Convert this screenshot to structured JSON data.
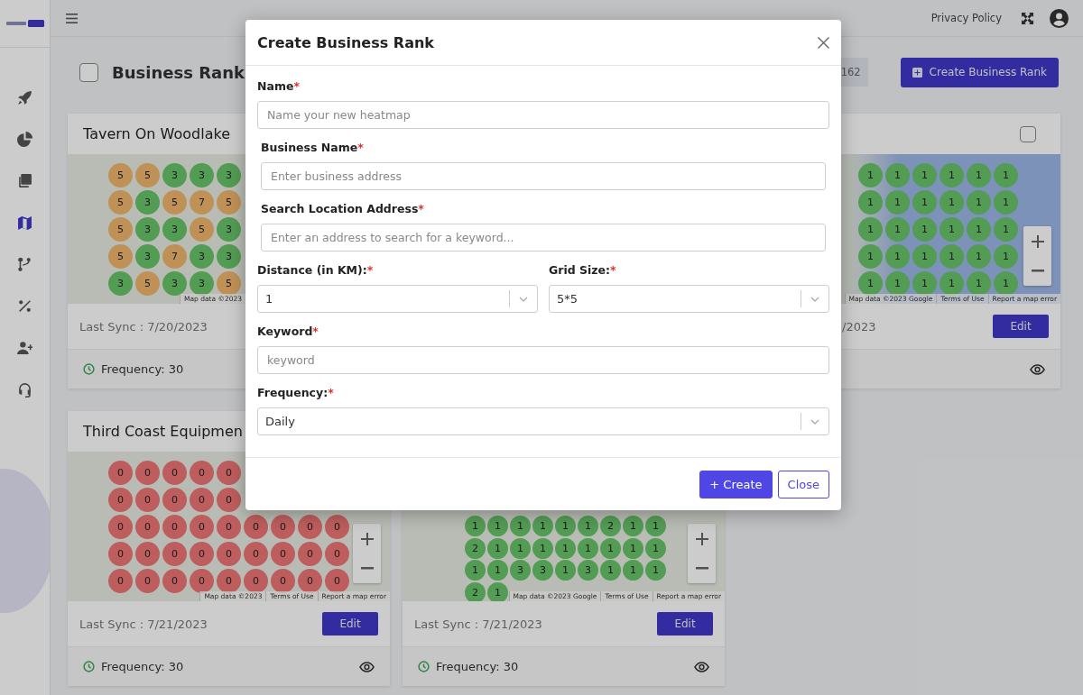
{
  "sidebar": {
    "items": [
      {
        "selected": false
      },
      {
        "selected": false
      },
      {
        "selected": false
      },
      {
        "selected": true
      },
      {
        "selected": false
      },
      {
        "selected": false
      },
      {
        "selected": false
      },
      {
        "selected": false
      }
    ]
  },
  "topbar": {
    "privacy_link": "Privacy Policy"
  },
  "header": {
    "title": "Business Rank",
    "select_all": {
      "checked": false
    },
    "count": "162",
    "create_button": "Create Business Rank"
  },
  "cards": [
    {
      "title": "Tavern On Woodlake",
      "rows": [
        [
          "5",
          "5",
          "3",
          "3",
          "3"
        ],
        [
          "5",
          "3",
          "5",
          "7",
          "5"
        ],
        [
          "5",
          "3",
          "3",
          "5",
          "3"
        ],
        [
          "5",
          "3",
          "7",
          "3",
          "3"
        ],
        [
          "3",
          "5",
          "3",
          "3",
          "5"
        ]
      ],
      "attribution": [
        "Map data ©2023"
      ],
      "last_sync": "Last Sync : 7/20/2023",
      "frequency": "Frequency: 30"
    },
    {
      "checkbox": {
        "checked": false
      },
      "rows": [
        [
          "1",
          "1",
          "1",
          "1",
          "1",
          "1"
        ],
        [
          "1",
          "1",
          "1",
          "1",
          "1",
          "1"
        ],
        [
          "1",
          "1",
          "1",
          "1",
          "1",
          "1"
        ],
        [
          "1",
          "1",
          "1",
          "1",
          "1",
          "1"
        ],
        [
          "1",
          "1",
          "1",
          "1",
          "1",
          "1"
        ]
      ],
      "zoom_controls": true,
      "attribution": [
        "Map data ©2023 Google",
        "Terms of Use",
        "Report a map error"
      ],
      "last_sync": "/2023",
      "edit_button": "Edit",
      "view_button": true
    },
    {
      "title": "Third Coast Equipmen",
      "rows": [
        [
          "0",
          "0",
          "0",
          "0",
          "0"
        ],
        [
          "0",
          "0",
          "0",
          "0",
          "0"
        ],
        [
          "0",
          "0",
          "0",
          "0",
          "0",
          "0",
          "0",
          "0",
          "0"
        ],
        [
          "0",
          "0",
          "0",
          "0",
          "0",
          "0",
          "0",
          "0",
          "0"
        ],
        [
          "0",
          "0",
          "0",
          "0",
          "0",
          "0",
          "0",
          "0",
          "0"
        ]
      ],
      "zoom_controls": true,
      "attribution": [
        "Map data ©2023",
        "Terms of Use",
        "Report a map error"
      ],
      "last_sync": "Last Sync : 7/21/2023",
      "edit_button": "Edit",
      "frequency": "Frequency: 30",
      "view_button": true
    },
    {
      "rows": [
        [
          "1",
          "1",
          "1",
          "1",
          "1",
          "1",
          "2",
          "1",
          "1"
        ],
        [
          "2",
          "1",
          "1",
          "1",
          "1",
          "1",
          "1",
          "1",
          "1"
        ],
        [
          "1",
          "1",
          "3",
          "3",
          "1",
          "3",
          "1",
          "1",
          "1"
        ],
        [
          "2",
          "1"
        ]
      ],
      "zoom_controls": true,
      "attribution": [
        "Map data ©2023 Google",
        "Terms of Use",
        "Report a map error"
      ],
      "last_sync": "Last Sync : 7/21/2023",
      "edit_button": "Edit",
      "frequency": "Frequency: 30",
      "view_button": true
    }
  ],
  "dialog": {
    "title": "Create Business Rank",
    "rows": [
      [
        {
          "kind": "input",
          "label": "Name",
          "mark": "*",
          "placeholder": "Name your new heatmap"
        }
      ],
      [
        {
          "kind": "input",
          "label": "Business Name",
          "mark": "*",
          "placeholder": "Enter business address"
        }
      ],
      [
        {
          "kind": "input",
          "label": "Search Location Address",
          "mark": "*",
          "placeholder": "Enter an address to search for a keyword..."
        }
      ],
      [
        {
          "kind": "select",
          "label": "Distance (in KM):",
          "mark": "*",
          "value": "1"
        },
        {
          "kind": "select",
          "label": "Grid Size:",
          "mark": "*",
          "value": "5*5"
        }
      ],
      [
        {
          "kind": "input",
          "label": "Keyword",
          "mark": "*",
          "placeholder": "keyword"
        }
      ],
      [
        {
          "kind": "select",
          "label": "Frequency:",
          "mark": "*",
          "value": "Daily"
        }
      ]
    ],
    "buttons": [
      {
        "kind": "primary",
        "label": "+ Create"
      },
      {
        "kind": "outline",
        "label": "Close"
      }
    ]
  }
}
